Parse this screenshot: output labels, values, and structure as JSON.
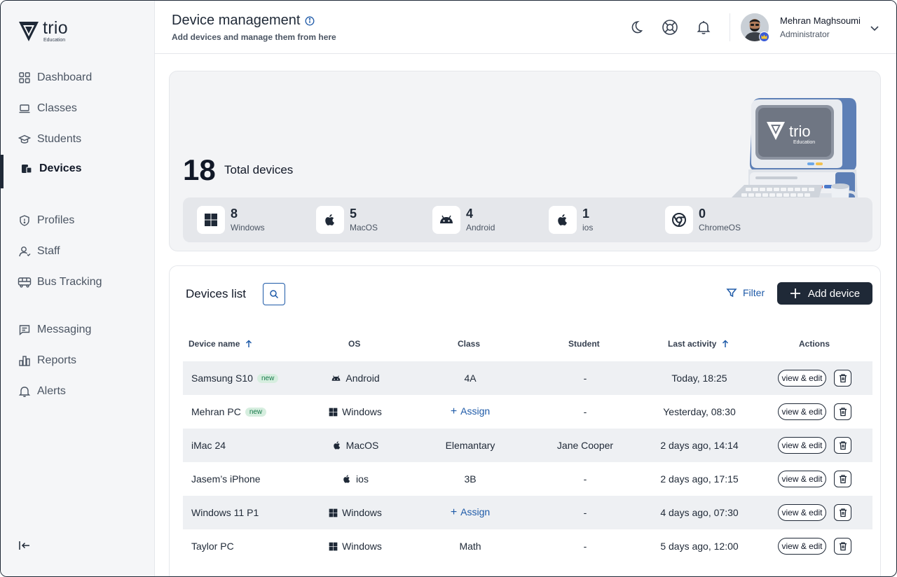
{
  "brand": {
    "name": "trio",
    "sub": "Education"
  },
  "sidebar": {
    "items": [
      {
        "label": "Dashboard",
        "icon": "grid-icon"
      },
      {
        "label": "Classes",
        "icon": "laptop-icon"
      },
      {
        "label": "Students",
        "icon": "graduation-cap-icon"
      },
      {
        "label": "Devices",
        "icon": "devices-icon",
        "active": true
      },
      {
        "label": "Profiles",
        "icon": "shield-icon"
      },
      {
        "label": "Staff",
        "icon": "user-icon"
      },
      {
        "label": "Bus Tracking",
        "icon": "bus-icon"
      },
      {
        "label": "Messaging",
        "icon": "message-icon"
      },
      {
        "label": "Reports",
        "icon": "bar-chart-icon"
      },
      {
        "label": "Alerts",
        "icon": "bell-icon"
      }
    ]
  },
  "header": {
    "title": "Device management",
    "subtitle": "Add devices and manage them from here",
    "user": {
      "name": "Mehran Maghsoumi",
      "role": "Administrator"
    }
  },
  "stats": {
    "total": "18",
    "total_label": "Total devices",
    "os": [
      {
        "count": "8",
        "name": "Windows",
        "icon": "windows-icon"
      },
      {
        "count": "5",
        "name": "MacOS",
        "icon": "apple-icon"
      },
      {
        "count": "4",
        "name": "Android",
        "icon": "android-icon"
      },
      {
        "count": "1",
        "name": "ios",
        "icon": "apple-icon"
      },
      {
        "count": "0",
        "name": "ChromeOS",
        "icon": "chrome-icon"
      }
    ],
    "illustration_text": {
      "brand": "trio",
      "sub": "Education"
    }
  },
  "list": {
    "title": "Devices list",
    "filter_label": "Filter",
    "add_label": "Add device",
    "columns": [
      "Device name",
      "OS",
      "Class",
      "Student",
      "Last activity",
      "Actions"
    ],
    "view_label": "view & edit",
    "assign_label": "Assign",
    "new_label": "new",
    "rows": [
      {
        "name": "Samsung S10",
        "new": true,
        "os": "Android",
        "class": "4A",
        "student": "-",
        "last": "Today, 18:25"
      },
      {
        "name": "Mehran PC",
        "new": true,
        "os": "Windows",
        "class": "",
        "student": "-",
        "last": "Yesterday, 08:30"
      },
      {
        "name": "iMac 24",
        "new": false,
        "os": "MacOS",
        "class": "Elemantary",
        "student": "Jane Cooper",
        "last": "2 days ago, 14:14"
      },
      {
        "name": "Jasem’s iPhone",
        "new": false,
        "os": "ios",
        "class": "3B",
        "student": "-",
        "last": "2 days ago, 17:15"
      },
      {
        "name": "Windows 11 P1",
        "new": false,
        "os": "Windows",
        "class": "",
        "student": "-",
        "last": "4 days ago, 07:30"
      },
      {
        "name": "Taylor PC",
        "new": false,
        "os": "Windows",
        "class": "Math",
        "student": "-",
        "last": "5 days ago, 12:00"
      }
    ]
  }
}
